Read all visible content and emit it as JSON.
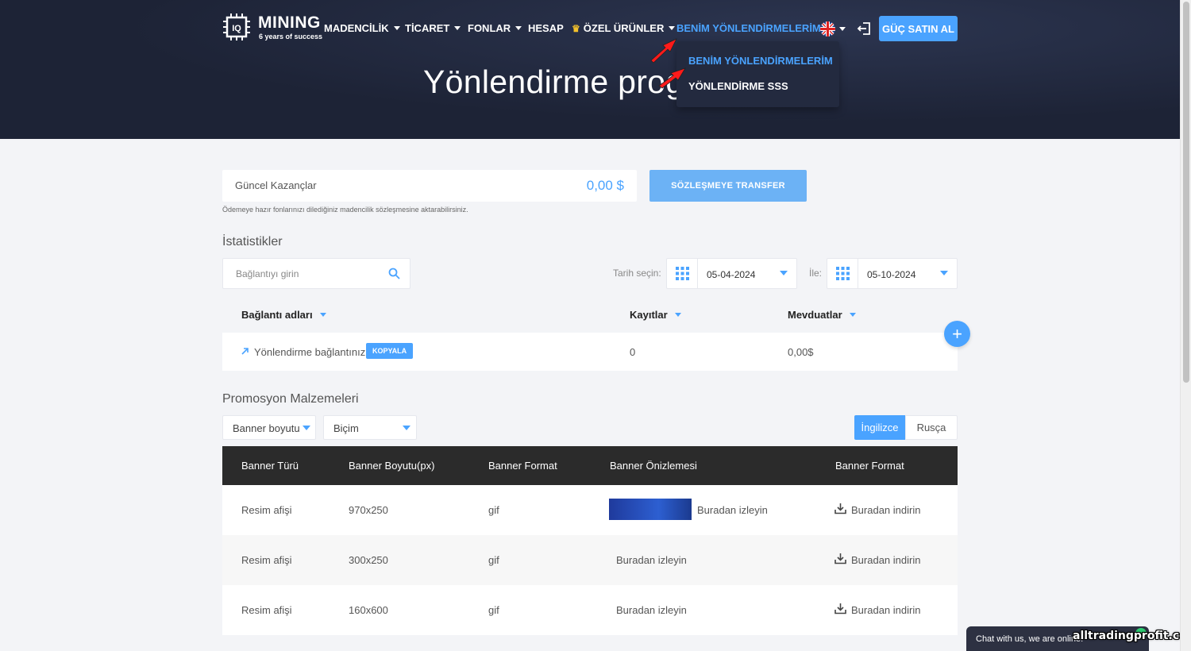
{
  "header": {
    "logo": {
      "name": "MINING",
      "tagline": "6 years of success",
      "chip_text": "IQ"
    },
    "nav": [
      {
        "label": "MADENCİLİK",
        "has_caret": true
      },
      {
        "label": "TİCARET",
        "has_caret": true
      },
      {
        "label": "FONLAR",
        "has_caret": true
      },
      {
        "label": "HESAP",
        "has_caret": false
      },
      {
        "label": "ÖZEL ÜRÜNLER",
        "has_caret": true,
        "icon": "crown-icon"
      },
      {
        "label": "BENİM YÖNLENDİRMELERİM",
        "has_caret": true,
        "active": true
      }
    ],
    "buy_button": "GÜÇ SATIN AL",
    "language_icon": "uk-flag-icon",
    "dropdown": [
      {
        "label": "BENİM YÖNLENDİRMELERİM",
        "selected": true
      },
      {
        "label": "YÖNLENDİRME SSS",
        "selected": false
      }
    ],
    "hero_title": "Yönlendirme prog"
  },
  "earnings": {
    "label": "Güncel Kazançlar",
    "value": "0,00 $",
    "transfer_button": "SÖZLEŞMEYE TRANSFER",
    "hint": "Ödemeye hazır fonlarınızı dilediğiniz madencilik sözleşmesine aktarabilirsiniz."
  },
  "stats": {
    "title": "İstatistikler",
    "search_placeholder": "Bağlantıyı girin",
    "date_label": "Tarih seçin:",
    "date_from": "05-04-2024",
    "to_label": "İle:",
    "date_to": "05-10-2024",
    "columns": [
      "Bağlantı adları",
      "Kayıtlar",
      "Mevduatlar"
    ],
    "rows": [
      {
        "name": "Yönlendirme bağlantınız",
        "copy": "KOPYALA",
        "registrations": "0",
        "deposits": "0,00$"
      }
    ]
  },
  "promo": {
    "title": "Promosyon Malzemeleri",
    "size_select": "Banner boyutu",
    "format_select": "Biçim",
    "languages": [
      "İngilizce",
      "Rusça"
    ],
    "columns": [
      "Banner Türü",
      "Banner Boyutu(px)",
      "Banner Format",
      "Banner Önizlemesi",
      "Banner Format"
    ],
    "rows": [
      {
        "type": "Resim afişi",
        "size": "970x250",
        "format": "gif",
        "preview": "Buradan izleyin",
        "download": "Buradan indirin",
        "has_thumb": true
      },
      {
        "type": "Resim afişi",
        "size": "300x250",
        "format": "gif",
        "preview": "Buradan izleyin",
        "download": "Buradan indirin",
        "has_thumb": false
      },
      {
        "type": "Resim afişi",
        "size": "160x600",
        "format": "gif",
        "preview": "Buradan izleyin",
        "download": "Buradan indirin",
        "has_thumb": false
      }
    ]
  },
  "chat": {
    "text": "Chat with us, we are online!"
  },
  "watermark": "alltradingprofit.com",
  "colors": {
    "accent": "#4aa3ff",
    "header_bg": "#1d2336",
    "table_head_bg": "#2b2b2b",
    "annotation_arrow": "#ff1a1a"
  }
}
